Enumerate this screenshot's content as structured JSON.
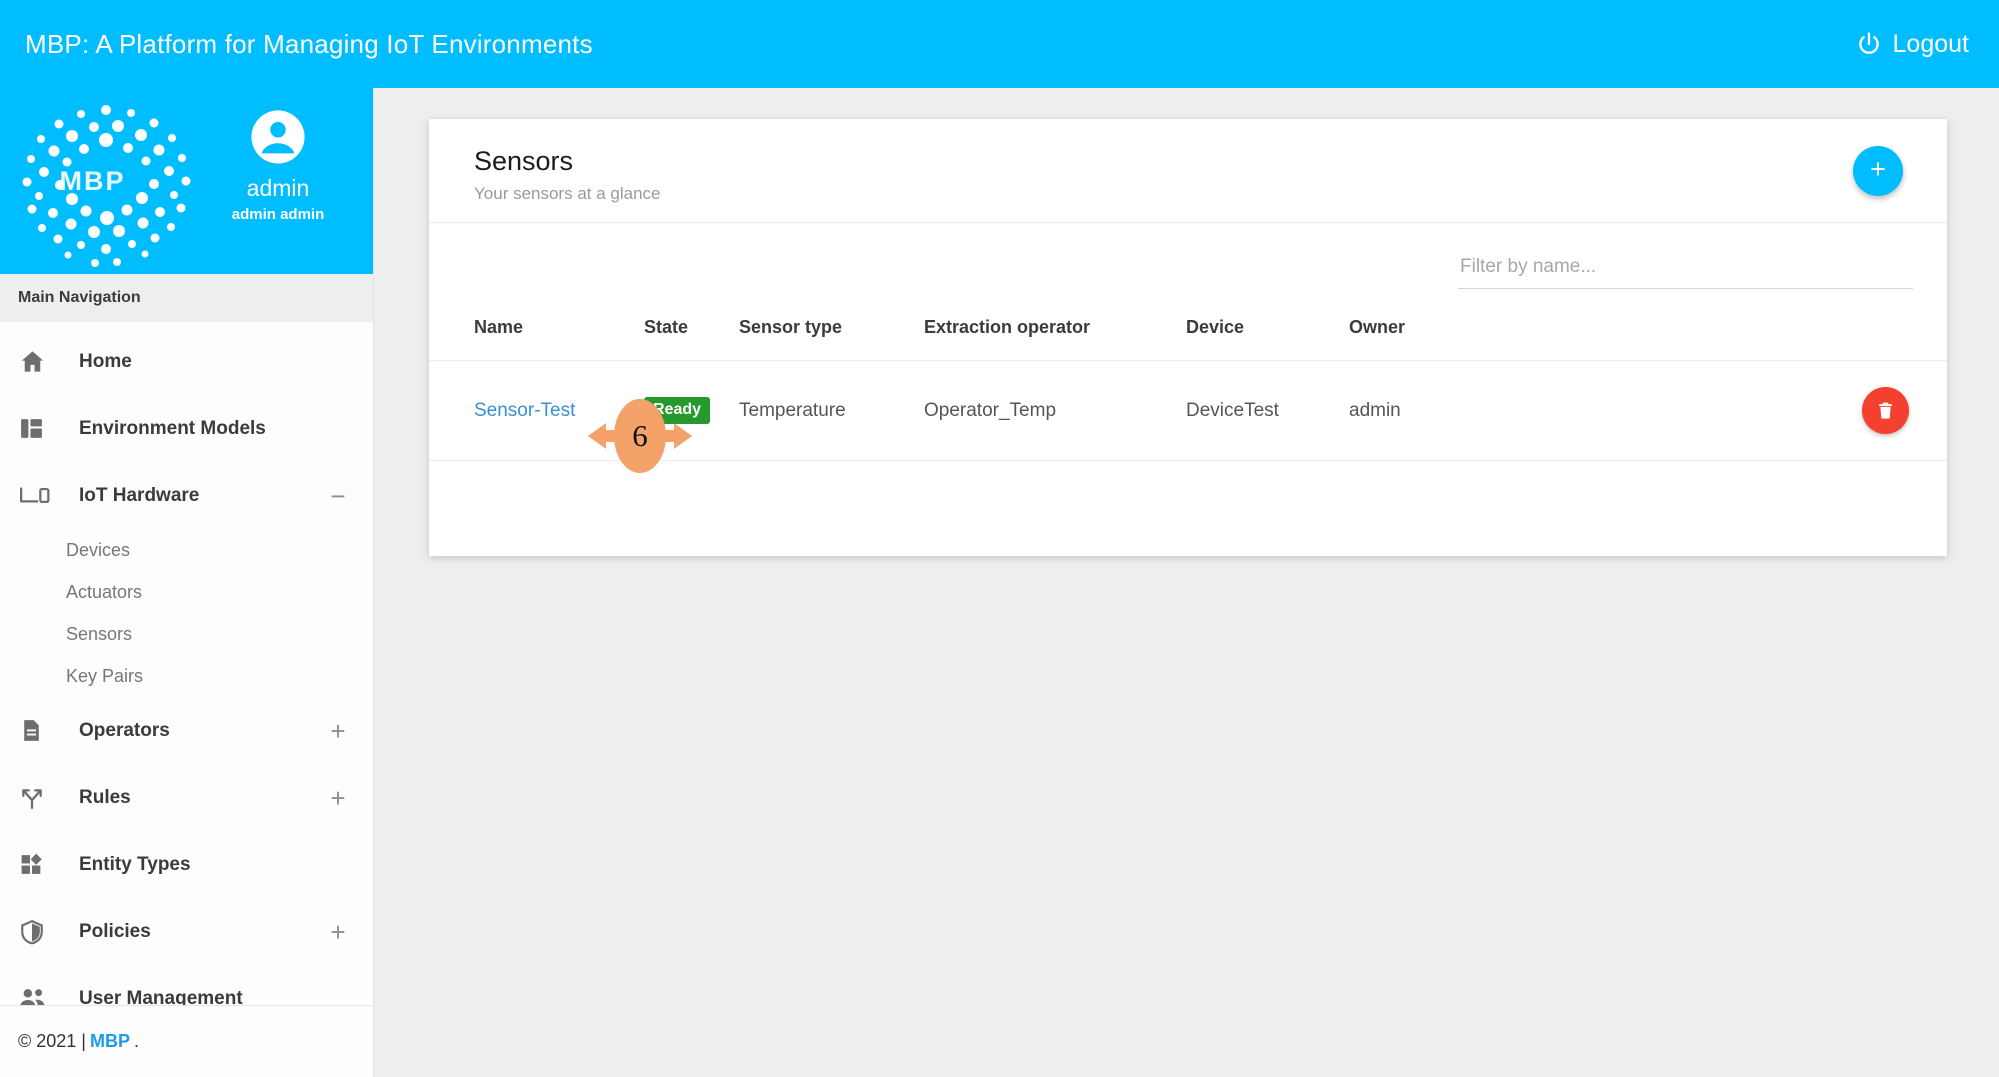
{
  "topbar": {
    "title": "MBP: A Platform for Managing IoT Environments",
    "logout_label": "Logout",
    "logout_icon": "power-icon",
    "background_color": "#00bdff"
  },
  "sidebar": {
    "logo_text": "MBP",
    "logo_icon": "mbp-dot-burst-logo",
    "avatar_icon": "user-avatar-icon",
    "user_name": "admin",
    "user_full_name": "admin admin",
    "section_label": "Main Navigation",
    "items": [
      {
        "label": "Home",
        "icon": "home-icon",
        "toggle": "",
        "children": []
      },
      {
        "label": "Environment Models",
        "icon": "dashboard-icon",
        "toggle": "",
        "children": []
      },
      {
        "label": "IoT Hardware",
        "icon": "device-icon",
        "toggle": "−",
        "children": [
          "Devices",
          "Actuators",
          "Sensors",
          "Key Pairs"
        ]
      },
      {
        "label": "Operators",
        "icon": "document-icon",
        "toggle": "+",
        "children": []
      },
      {
        "label": "Rules",
        "icon": "branch-icon",
        "toggle": "+",
        "children": []
      },
      {
        "label": "Entity Types",
        "icon": "shapes-icon",
        "toggle": "",
        "children": []
      },
      {
        "label": "Policies",
        "icon": "shield-icon",
        "toggle": "+",
        "children": []
      },
      {
        "label": "User Management",
        "icon": "people-icon",
        "toggle": "",
        "children": []
      }
    ],
    "footer_copyright": "© 2021 |",
    "footer_link": "MBP",
    "footer_suffix": "."
  },
  "card": {
    "title": "Sensors",
    "subtitle": "Your sensors at a glance",
    "add_button_label": "+",
    "add_button_icon": "plus-icon"
  },
  "filter": {
    "placeholder": "Filter by name...",
    "value": ""
  },
  "table": {
    "columns": [
      "Name",
      "State",
      "Sensor type",
      "Extraction operator",
      "Device",
      "Owner"
    ],
    "rows": [
      {
        "name": "Sensor-Test",
        "state": "Ready",
        "state_color": "#25992c",
        "sensor_type": "Temperature",
        "extraction_operator": "Operator_Temp",
        "device": "DeviceTest",
        "owner": "admin",
        "delete_icon": "trash-icon"
      }
    ]
  },
  "annotation": {
    "number": "6",
    "color": "#f4a16a",
    "shape": "ellipse-with-double-arrow"
  }
}
